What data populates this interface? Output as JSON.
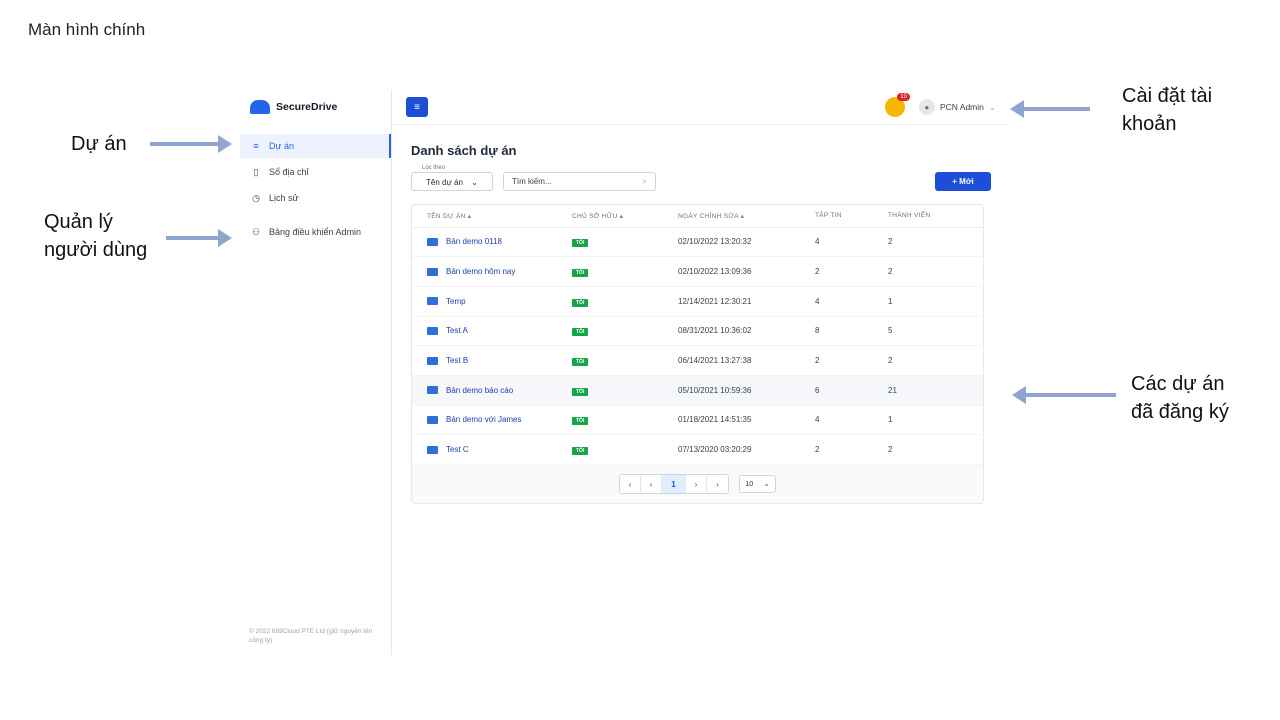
{
  "slide": {
    "title": "Màn hình chính"
  },
  "annotations": {
    "projects": "Dự án",
    "user_mgmt_line1": "Quản lý",
    "user_mgmt_line2": "người dùng",
    "account_line1": "Cài đặt tài",
    "account_line2": "khoản",
    "registered_line1": "Các dự án",
    "registered_line2": "đã đăng ký"
  },
  "sidebar": {
    "brand": "SecureDrive",
    "items": [
      {
        "label": "Dự án",
        "icon": "list-icon",
        "glyph": "≡",
        "active": true
      },
      {
        "label": "Sổ địa chỉ",
        "icon": "book-icon",
        "glyph": "▯",
        "active": false
      },
      {
        "label": "Lịch sử",
        "icon": "clock-icon",
        "glyph": "◷",
        "active": false
      },
      {
        "label": "Bảng điều khiển Admin",
        "icon": "users-icon",
        "glyph": "⚇",
        "active": false
      }
    ],
    "footer": "© 2022 689Cloud PTE Ltd (giữ nguyên tên công ty)"
  },
  "topbar": {
    "notification_count": "10",
    "user_name": "PCN Admin"
  },
  "main": {
    "title": "Danh sách dự án",
    "filter_label": "Lọc theo",
    "filter_value": "Tên dự án",
    "search_placeholder": "Tìm kiếm...",
    "new_button": "+ Mới"
  },
  "table": {
    "headers": [
      "TÊN DỰ ÁN ▴",
      "CHỦ SỞ HỮU ▴",
      "NGÀY CHỈNH SỬA ▴",
      "TẬP TIN",
      "THÀNH VIÊN"
    ],
    "owner_badge": "TÔI",
    "rows": [
      {
        "name": "Bản demo 0118",
        "modified": "02/10/2022 13:20:32",
        "files": "4",
        "members": "2"
      },
      {
        "name": "Bản demo hôm nay",
        "modified": "02/10/2022 13:09:36",
        "files": "2",
        "members": "2"
      },
      {
        "name": "Temp",
        "modified": "12/14/2021 12:30:21",
        "files": "4",
        "members": "1"
      },
      {
        "name": "Test A",
        "modified": "08/31/2021 10:36:02",
        "files": "8",
        "members": "5"
      },
      {
        "name": "Test B",
        "modified": "06/14/2021 13:27:38",
        "files": "2",
        "members": "2"
      },
      {
        "name": "Bản demo báo cáo",
        "modified": "05/10/2021 10:59:36",
        "files": "6",
        "members": "21"
      },
      {
        "name": "Bản demo với James",
        "modified": "01/18/2021 14:51:35",
        "files": "4",
        "members": "1"
      },
      {
        "name": "Test C",
        "modified": "07/13/2020 03:20:29",
        "files": "2",
        "members": "2"
      }
    ]
  },
  "pagination": {
    "current": "1",
    "page_size": "10"
  }
}
